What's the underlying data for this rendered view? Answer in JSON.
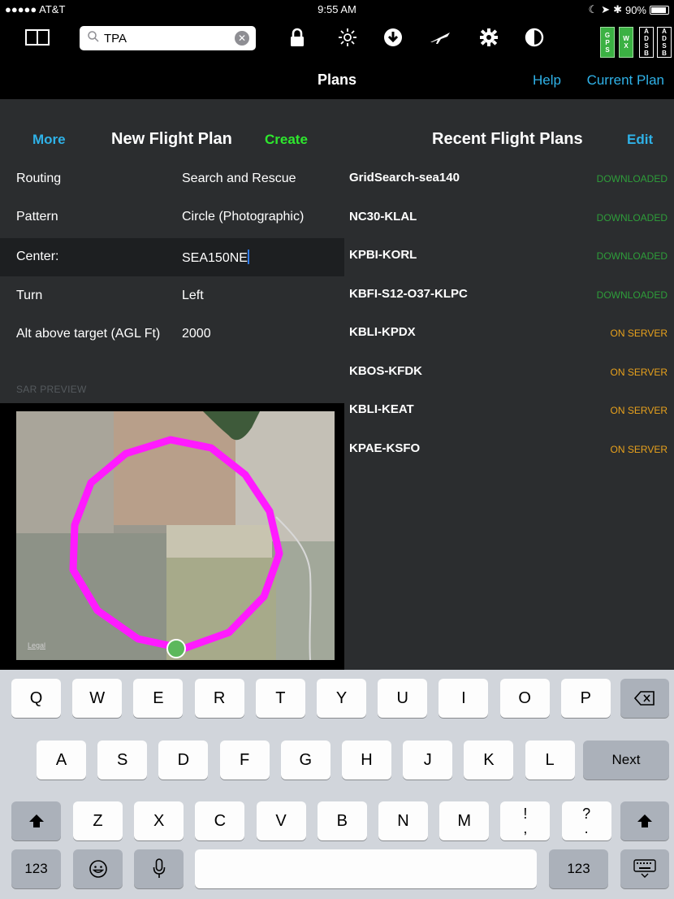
{
  "status_bar": {
    "carrier": "●●●●● AT&T",
    "time": "9:55 AM",
    "battery": "90%",
    "battery_level": 0.9
  },
  "toolbar": {
    "search_value": "TPA",
    "icons": [
      "split-view-icon",
      "lock-icon",
      "brightness-icon",
      "download-icon",
      "airplane-icon",
      "gear-icon",
      "contrast-icon"
    ],
    "status_tiles": [
      {
        "name": "gps-status",
        "letters": [
          "G",
          "P",
          "S"
        ],
        "color": "#3bb143"
      },
      {
        "name": "wx-status",
        "letters": [
          "W",
          "X"
        ],
        "color": "#3bb143"
      },
      {
        "name": "adsb-status-1",
        "letters": [
          "A",
          "D",
          "S",
          "B"
        ],
        "color": "#000000"
      },
      {
        "name": "adsb-status-2",
        "letters": [
          "A",
          "D",
          "S",
          "B"
        ],
        "color": "#000000"
      }
    ]
  },
  "title_bar": {
    "title": "Plans",
    "help": "Help",
    "current_plan": "Current Plan"
  },
  "new_flight_plan": {
    "more": "More",
    "title": "New Flight Plan",
    "create": "Create",
    "fields": [
      {
        "label": "Routing",
        "value": "Search and Rescue"
      },
      {
        "label": "Pattern",
        "value": "Circle (Photographic)"
      },
      {
        "label": "Center:",
        "value": "SEA150NE"
      },
      {
        "label": "Turn",
        "value": "Left"
      },
      {
        "label": "Alt above target (AGL Ft)",
        "value": "2000"
      }
    ],
    "preview_label": "SAR PREVIEW",
    "map_legal": "Legal"
  },
  "recent_flight_plans": {
    "title": "Recent Flight Plans",
    "edit": "Edit",
    "plans": [
      {
        "name": "GridSearch-sea140",
        "status": "DOWNLOADED"
      },
      {
        "name": "NC30-KLAL",
        "status": "DOWNLOADED"
      },
      {
        "name": "KPBI-KORL",
        "status": "DOWNLOADED"
      },
      {
        "name": "KBFI-S12-O37-KLPC",
        "status": "DOWNLOADED"
      },
      {
        "name": "KBLI-KPDX",
        "status": "ON SERVER"
      },
      {
        "name": "KBOS-KFDK",
        "status": "ON SERVER"
      },
      {
        "name": "KBLI-KEAT",
        "status": "ON SERVER"
      },
      {
        "name": "KPAE-KSFO",
        "status": "ON SERVER"
      }
    ],
    "colors": {
      "downloaded": "#2e9e3a",
      "on_server": "#e8a11c"
    }
  },
  "keyboard": {
    "row1": [
      "Q",
      "W",
      "E",
      "R",
      "T",
      "Y",
      "U",
      "I",
      "O",
      "P"
    ],
    "row2": [
      "A",
      "S",
      "D",
      "F",
      "G",
      "H",
      "J",
      "K",
      "L"
    ],
    "row3": [
      "Z",
      "X",
      "C",
      "V",
      "B",
      "N",
      "M"
    ],
    "punct": [
      [
        "!",
        ","
      ],
      [
        "?",
        "."
      ]
    ],
    "next": "Next",
    "numbers": "123"
  },
  "colors": {
    "accent": "#2fb2e8",
    "create": "#2ee82e",
    "pattern": "#ff1aff"
  }
}
